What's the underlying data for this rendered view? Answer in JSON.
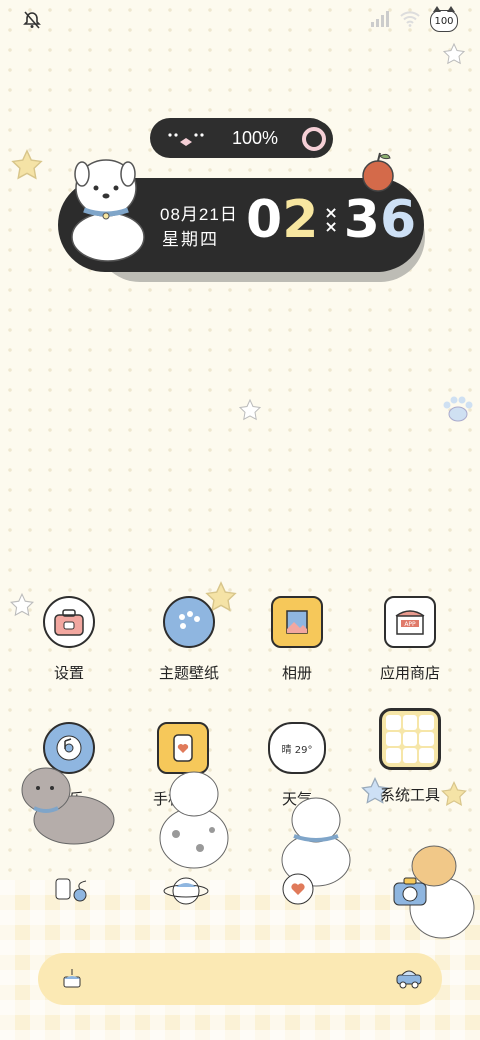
{
  "status_bar": {
    "left_icon": "mute-bell-icon",
    "signal_icon": "signal-icon",
    "wifi_icon": "wifi-icon",
    "battery_text": "100"
  },
  "widget": {
    "battery_percent": "100%",
    "date": "08月21日",
    "weekday": "星期四",
    "time_h1": "0",
    "time_h2": "2",
    "time_m1": "3",
    "time_m2": "6"
  },
  "apps_row1": [
    {
      "label": "设置",
      "icon": "toolbox-cat-icon"
    },
    {
      "label": "主题壁纸",
      "icon": "palette-cat-icon"
    },
    {
      "label": "相册",
      "icon": "photo-frame-cat-icon"
    },
    {
      "label": "应用商店",
      "icon": "store-icon"
    }
  ],
  "apps_row2": [
    {
      "label": "音乐",
      "icon": "music-disc-icon"
    },
    {
      "label": "手机管家",
      "icon": "phone-heart-icon"
    },
    {
      "label": "天气",
      "icon": "weather-cloud-icon",
      "weather_text": "晴 29°"
    },
    {
      "label": "系统工具",
      "icon": "system-tools-folder-icon"
    }
  ],
  "dock_row": [
    {
      "icon": "phone-cat-icon"
    },
    {
      "icon": "planet-cat-icon"
    },
    {
      "icon": "heart-car-icon"
    },
    {
      "icon": "camera-cat-icon"
    }
  ],
  "colors": {
    "widget_bg": "#2c2c2c",
    "accent_yellow": "#f7e6a0",
    "accent_blue": "#cde0f5",
    "ring_pink": "#f5cfd6",
    "dock": "#fbe9b4"
  }
}
